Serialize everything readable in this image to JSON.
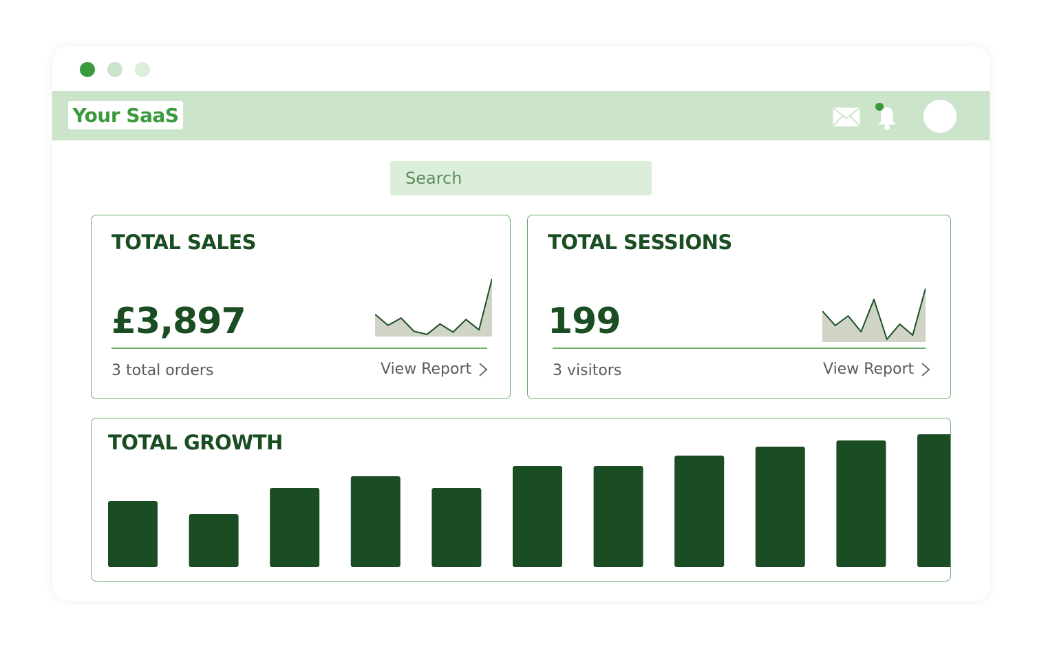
{
  "window": {
    "dots": [
      "#3a9a3c",
      "#cbe4ca",
      "#dbeeda"
    ]
  },
  "header": {
    "logo_text": "Your SaaS",
    "mail_icon": "mail-icon",
    "bell_icon": "bell-icon",
    "notification_dot_color": "#3a9a3c"
  },
  "search": {
    "placeholder": "Search"
  },
  "sales_card": {
    "title": "TOTAL SALES",
    "value": "£3,897",
    "subtext": "3 total orders",
    "link_label": "View Report"
  },
  "sessions_card": {
    "title": "TOTAL SESSIONS",
    "value": "199",
    "subtext": "3 visitors",
    "link_label": "View Report"
  },
  "growth_card": {
    "title": "TOTAL GROWTH"
  },
  "colors": {
    "accent": "#3a9a3c",
    "dark_green": "#1b4d25",
    "topbar": "#cbe4ca",
    "spark_fill": "#cfd4c6"
  },
  "chart_data": [
    {
      "type": "area",
      "name": "sales-sparkline",
      "values": [
        3,
        1.5,
        2.5,
        0.7,
        0.3,
        1.7,
        0.6,
        2.3,
        0.9,
        7.8
      ]
    },
    {
      "type": "area",
      "name": "sessions-sparkline",
      "values": [
        4.5,
        2.4,
        3.8,
        1.5,
        6.2,
        0.4,
        2.6,
        1.0,
        7.8
      ]
    },
    {
      "type": "bar",
      "values": [
        96,
        77,
        115,
        132,
        115,
        147,
        147,
        162,
        175,
        184,
        193
      ]
    }
  ]
}
